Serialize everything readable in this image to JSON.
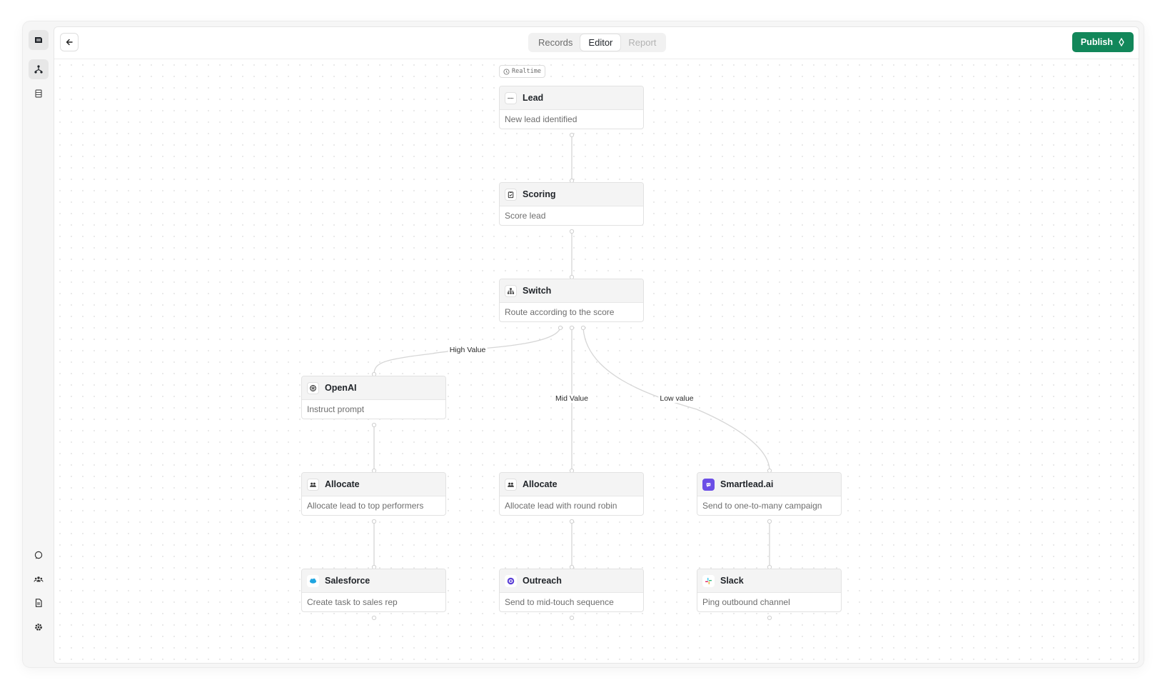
{
  "topbar": {
    "tabs": [
      {
        "label": "Records",
        "state": "normal"
      },
      {
        "label": "Editor",
        "state": "active"
      },
      {
        "label": "Report",
        "state": "disabled"
      }
    ],
    "publish_label": "Publish"
  },
  "canvas": {
    "trigger_badge": "Realtime",
    "nodes": [
      {
        "title": "Lead",
        "description": "New lead identified",
        "icon": "lead-icon"
      },
      {
        "title": "Scoring",
        "description": "Score lead",
        "icon": "clipboard-icon"
      },
      {
        "title": "Switch",
        "description": "Route according to the score",
        "icon": "branch-icon"
      },
      {
        "title": "OpenAI",
        "description": "Instruct prompt",
        "icon": "openai-icon"
      },
      {
        "title": "Allocate",
        "description": "Allocate lead to top performers",
        "icon": "users-icon"
      },
      {
        "title": "Allocate",
        "description": "Allocate lead with round robin",
        "icon": "users-icon"
      },
      {
        "title": "Smartlead.ai",
        "description": "Send to one-to-many campaign",
        "icon": "smartlead-icon"
      },
      {
        "title": "Salesforce",
        "description": "Create task to sales rep",
        "icon": "salesforce-icon"
      },
      {
        "title": "Outreach",
        "description": "Send to mid-touch sequence",
        "icon": "outreach-icon"
      },
      {
        "title": "Slack",
        "description": "Ping outbound channel",
        "icon": "slack-icon"
      }
    ],
    "edge_labels": {
      "high": "High Value",
      "mid": "Mid Value",
      "low": "Low value"
    }
  },
  "colors": {
    "publish": "#12875a",
    "edge": "#d6d6d6",
    "outreach": "#5a3fd6",
    "smartlead": "#6b4ee6",
    "salesforce": "#1fa5e0"
  }
}
